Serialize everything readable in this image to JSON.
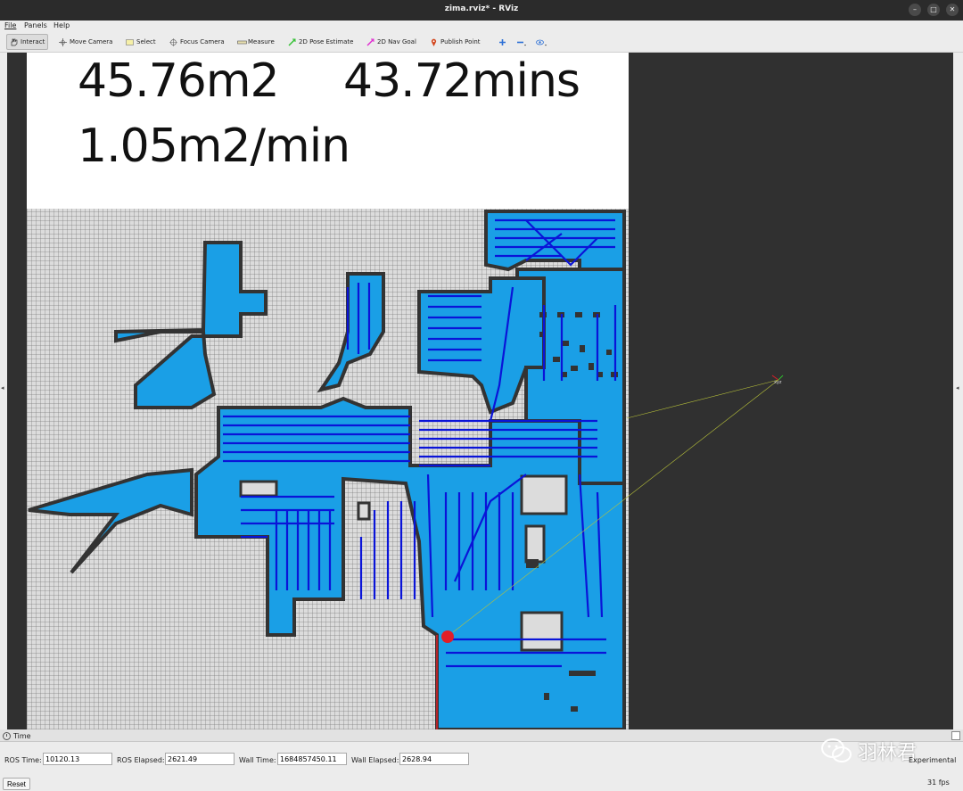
{
  "window": {
    "title": "zima.rviz* - RViz"
  },
  "menu": {
    "file": "File",
    "panels": "Panels",
    "help": "Help"
  },
  "toolbar": {
    "interact": "Interact",
    "move_camera": "Move Camera",
    "select": "Select",
    "focus_camera": "Focus Camera",
    "measure": "Measure",
    "pose_estimate": "2D Pose Estimate",
    "nav_goal": "2D Nav Goal",
    "publish_point": "Publish Point"
  },
  "overlay": {
    "area": "45.76m2",
    "duration": "43.72mins",
    "rate": "1.05m2/min"
  },
  "viewport": {
    "axis_label": "xyz",
    "colors": {
      "coverage": "#1a9fe6",
      "path": "#0a14d8",
      "wall": "#333333",
      "free": "#dcdcdc"
    }
  },
  "time_panel": {
    "title": "Time",
    "ros_time_label": "ROS Time:",
    "ros_time": "10120.13",
    "ros_elapsed_label": "ROS Elapsed:",
    "ros_elapsed": "2621.49",
    "wall_time_label": "Wall Time:",
    "wall_time": "1684857450.11",
    "wall_elapsed_label": "Wall Elapsed:",
    "wall_elapsed": "2628.94",
    "experimental": "Experimental",
    "reset": "Reset",
    "fps": "31 fps"
  },
  "watermark": {
    "text": "羽林君"
  }
}
